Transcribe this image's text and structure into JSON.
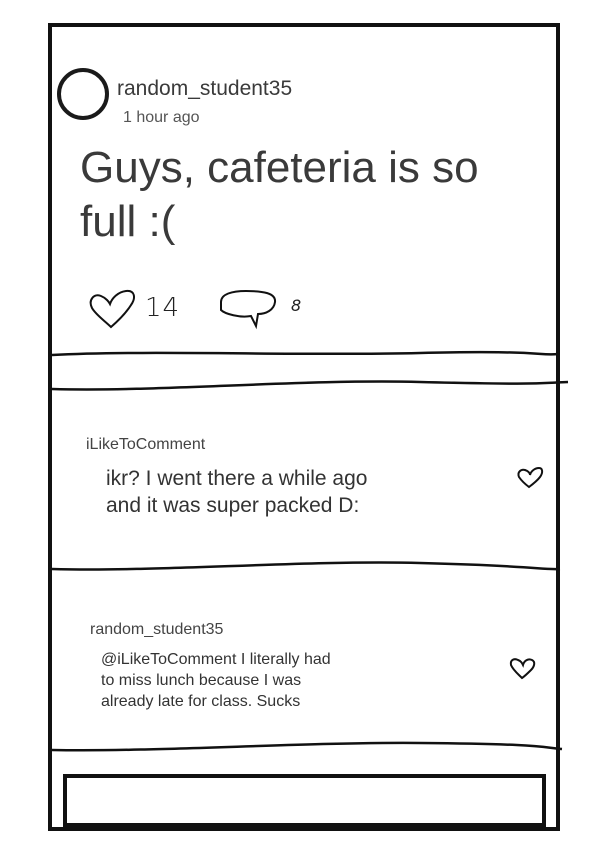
{
  "post": {
    "username": "random_student35",
    "timestamp": "1 hour ago",
    "text": "Guys, cafeteria is so full :(",
    "like_count": "14",
    "reply_count": "8"
  },
  "comments": [
    {
      "username": "iLikeToComment",
      "text": "ikr? I went there a while ago and it was super packed D:"
    },
    {
      "username": "random_student35",
      "text": "@iLikeToComment I literally had to miss lunch because I was already late for class. Sucks"
    }
  ],
  "icons": {
    "like": "heart-icon",
    "reply": "speech-bubble-icon",
    "avatar": "circle-avatar"
  },
  "colors": {
    "ink": "#111111",
    "text": "#333333"
  }
}
